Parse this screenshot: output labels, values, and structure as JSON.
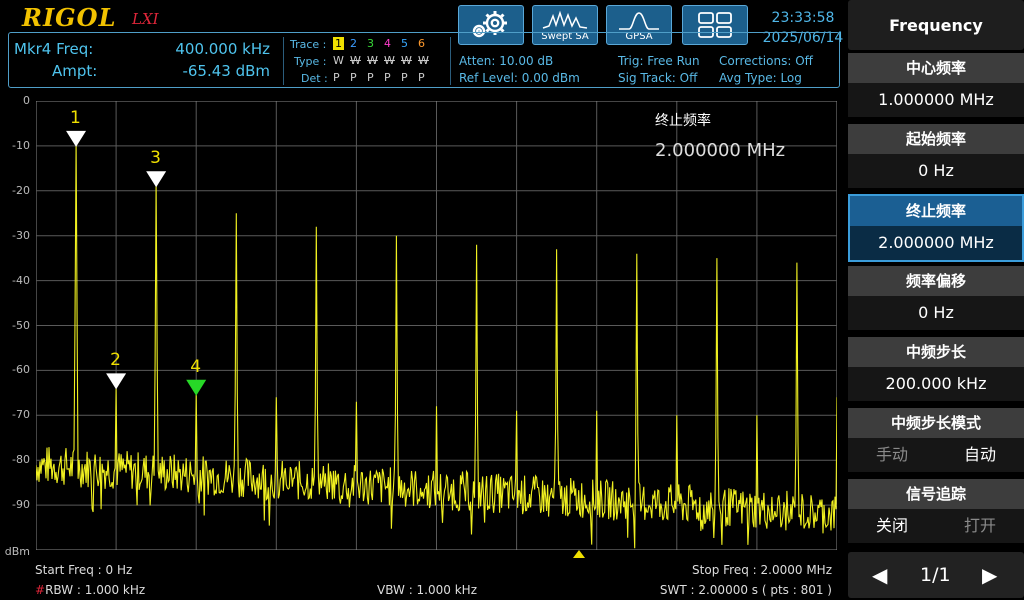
{
  "header": {
    "logo": "RIGOL",
    "logo_suffix": "LXI",
    "buttons": [
      {
        "name": "settings-icon",
        "label": ""
      },
      {
        "name": "swept-sa",
        "label": "Swept SA"
      },
      {
        "name": "gpsa",
        "label": "GPSA"
      },
      {
        "name": "window-layout-icon",
        "label": ""
      }
    ],
    "time": "23:33:58",
    "date": "2025/06/14"
  },
  "marker_readout": {
    "freq_label": "Mkr4 Freq:",
    "freq_value": "400.000 kHz",
    "ampt_label": "Ampt:",
    "ampt_value": "-65.43 dBm"
  },
  "trace_info": {
    "trace_label": "Trace :",
    "type_label": "Type :",
    "det_label": "Det :",
    "traces": [
      "1",
      "2",
      "3",
      "4",
      "5",
      "6"
    ],
    "trace_colors": [
      "#000000",
      "#3c9cff",
      "#38d838",
      "#ff3ccc",
      "#38a8ff",
      "#ff9a2e"
    ],
    "types": [
      "W",
      "W",
      "W",
      "W",
      "W",
      "W"
    ],
    "dets": [
      "P",
      "P",
      "P",
      "P",
      "P",
      "P"
    ]
  },
  "settings_info": {
    "atten": "Atten: 10.00 dB",
    "ref_level": "Ref Level: 0.00 dBm",
    "trig": "Trig: Free Run",
    "sig_track": "Sig Track: Off",
    "corrections": "Corrections: Off",
    "avg_type": "Avg Type: Log"
  },
  "overlay": {
    "param_name": "终止频率",
    "param_value": "2.000000 MHz"
  },
  "markers": [
    {
      "label": "1",
      "freq_khz": 100,
      "dbm": -10,
      "color": "#ffffff"
    },
    {
      "label": "2",
      "freq_khz": 200,
      "dbm": -64,
      "color": "#ffffff"
    },
    {
      "label": "3",
      "freq_khz": 300,
      "dbm": -19,
      "color": "#ffffff"
    },
    {
      "label": "4",
      "freq_khz": 400,
      "dbm": -65.43,
      "color": "#27d827"
    }
  ],
  "chart_data": {
    "type": "line",
    "ylabel": "dBm",
    "y_ticks": [
      "0",
      "-10",
      "-20",
      "-30",
      "-40",
      "-50",
      "-60",
      "-70",
      "-80",
      "-90"
    ],
    "ylim": [
      -100,
      0
    ],
    "xlim_khz": [
      0,
      2000
    ],
    "grid": true,
    "trace_color": "#f0f020",
    "noise_floor_dbm": [
      -81,
      -92
    ],
    "peaks": [
      {
        "freq_khz": 100,
        "dbm": -9
      },
      {
        "freq_khz": 200,
        "dbm": -64
      },
      {
        "freq_khz": 300,
        "dbm": -18
      },
      {
        "freq_khz": 400,
        "dbm": -65.4
      },
      {
        "freq_khz": 500,
        "dbm": -25
      },
      {
        "freq_khz": 600,
        "dbm": -66
      },
      {
        "freq_khz": 700,
        "dbm": -28
      },
      {
        "freq_khz": 800,
        "dbm": -67
      },
      {
        "freq_khz": 900,
        "dbm": -30
      },
      {
        "freq_khz": 1000,
        "dbm": -68
      },
      {
        "freq_khz": 1100,
        "dbm": -32
      },
      {
        "freq_khz": 1200,
        "dbm": -69
      },
      {
        "freq_khz": 1300,
        "dbm": -33
      },
      {
        "freq_khz": 1400,
        "dbm": -69
      },
      {
        "freq_khz": 1500,
        "dbm": -34
      },
      {
        "freq_khz": 1600,
        "dbm": -70
      },
      {
        "freq_khz": 1700,
        "dbm": -35
      },
      {
        "freq_khz": 1800,
        "dbm": -70
      },
      {
        "freq_khz": 1900,
        "dbm": -36
      },
      {
        "freq_khz": 2000,
        "dbm": -66
      }
    ]
  },
  "bottom": {
    "start_freq": "Start Freq : 0 Hz",
    "stop_freq": "Stop Freq : 2.0000 MHz",
    "rbw_prefix": "#",
    "rbw": "RBW : 1.000 kHz",
    "vbw": "VBW : 1.000 kHz",
    "swt": "SWT : 2.00000 s ( pts : 801 )"
  },
  "softkeys": {
    "title": "Frequency",
    "items": [
      {
        "label": "中心频率",
        "value": "1.000000 MHz"
      },
      {
        "label": "起始频率",
        "value": "0 Hz"
      },
      {
        "label": "终止频率",
        "value": "2.000000 MHz"
      },
      {
        "label": "频率偏移",
        "value": "0 Hz"
      },
      {
        "label": "中频步长",
        "value": "200.000 kHz"
      }
    ],
    "step_mode": {
      "label": "中频步长模式",
      "opt_a": "手动",
      "opt_b": "自动"
    },
    "sig_track": {
      "label": "信号追踪",
      "opt_a": "关闭",
      "opt_b": "打开"
    },
    "page": "1/1"
  }
}
